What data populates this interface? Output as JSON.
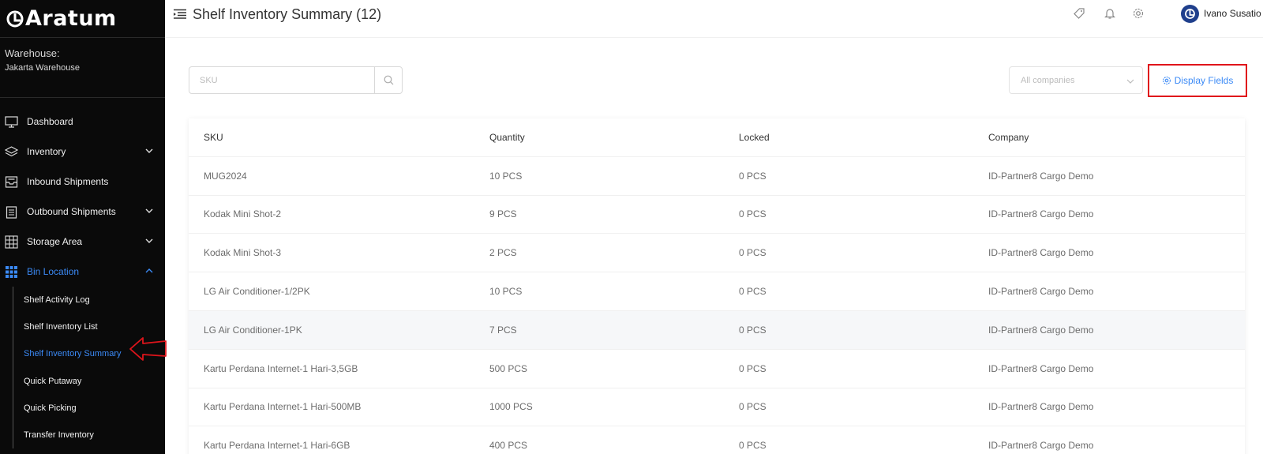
{
  "app": {
    "logo_text": "Aratum"
  },
  "warehouse": {
    "label": "Warehouse:",
    "value": "Jakarta Warehouse"
  },
  "sidebar": {
    "items": [
      {
        "label": "Dashboard",
        "icon": "monitor-icon"
      },
      {
        "label": "Inventory",
        "icon": "layers-icon"
      },
      {
        "label": "Inbound Shipments",
        "icon": "inbox-icon"
      },
      {
        "label": "Outbound Shipments",
        "icon": "clipboard-icon"
      },
      {
        "label": "Storage Area",
        "icon": "grid-icon"
      },
      {
        "label": "Bin Location",
        "icon": "apps-icon"
      }
    ],
    "sub_items": [
      "Shelf Activity Log",
      "Shelf Inventory List",
      "Shelf Inventory Summary",
      "Quick Putaway",
      "Quick Picking",
      "Transfer Inventory"
    ],
    "active_sub": "Shelf Inventory Summary"
  },
  "header": {
    "title": "Shelf Inventory Summary (12)",
    "user_name": "Ivano Susatio",
    "icons": [
      "tag-icon",
      "bell-icon",
      "gear-icon"
    ]
  },
  "filters": {
    "search_placeholder": "SKU",
    "company_placeholder": "All companies",
    "display_fields_label": "Display Fields"
  },
  "table": {
    "columns": [
      "SKU",
      "Quantity",
      "Locked",
      "Company"
    ],
    "rows": [
      [
        "MUG2024",
        "10 PCS",
        "0 PCS",
        "ID-Partner8 Cargo Demo"
      ],
      [
        "Kodak Mini Shot-2",
        "9 PCS",
        "0 PCS",
        "ID-Partner8 Cargo Demo"
      ],
      [
        "Kodak Mini Shot-3",
        "2 PCS",
        "0 PCS",
        "ID-Partner8 Cargo Demo"
      ],
      [
        "LG Air Conditioner-1/2PK",
        "10 PCS",
        "0 PCS",
        "ID-Partner8 Cargo Demo"
      ],
      [
        "LG Air Conditioner-1PK",
        "7 PCS",
        "0 PCS",
        "ID-Partner8 Cargo Demo"
      ],
      [
        "Kartu Perdana Internet-1 Hari-3,5GB",
        "500 PCS",
        "0 PCS",
        "ID-Partner8 Cargo Demo"
      ],
      [
        "Kartu Perdana Internet-1 Hari-500MB",
        "1000 PCS",
        "0 PCS",
        "ID-Partner8 Cargo Demo"
      ],
      [
        "Kartu Perdana Internet-1 Hari-6GB",
        "400 PCS",
        "0 PCS",
        "ID-Partner8 Cargo Demo"
      ]
    ]
  },
  "colors": {
    "sidebar_bg": "#0a0a0a",
    "accent": "#3b8af6",
    "highlight_box": "#e0141b"
  }
}
